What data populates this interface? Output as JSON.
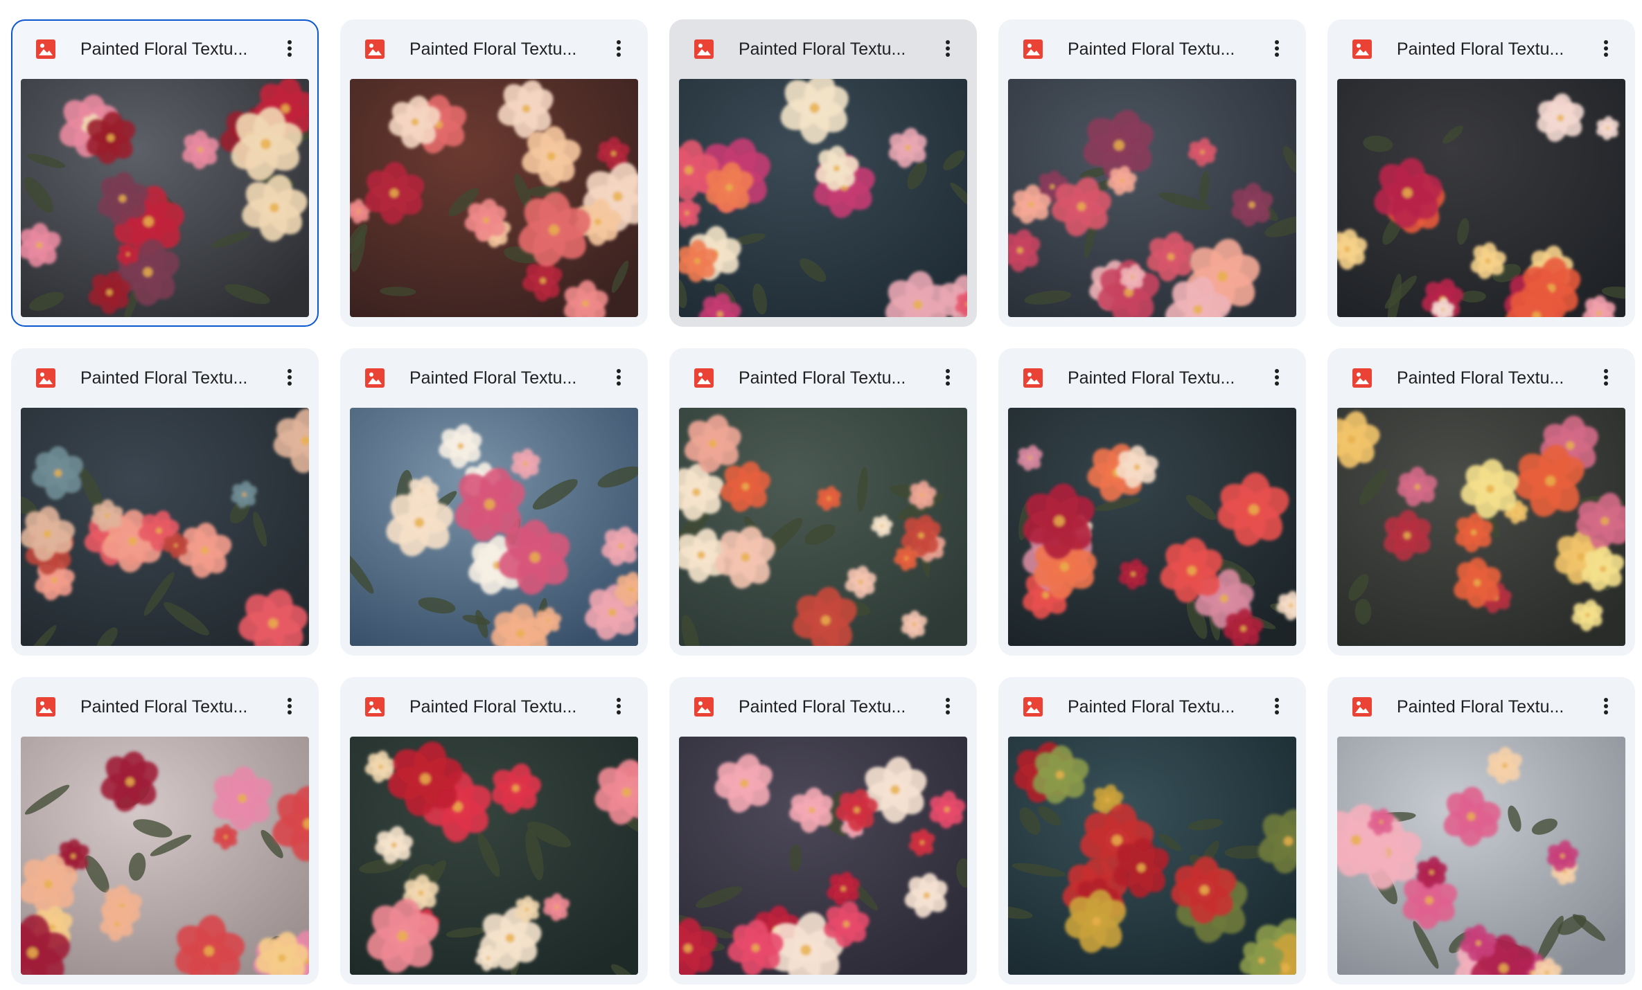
{
  "files": [
    {
      "name": "Painted Floral Textu...",
      "icon": "image-file-icon",
      "state": "selected",
      "palette": {
        "bg": "#2d2f33",
        "fog": "#5d6068",
        "flowers": [
          "#e98aa0",
          "#c2243a",
          "#f1d8b4",
          "#9a1c2b",
          "#7a3a52"
        ]
      }
    },
    {
      "name": "Painted Floral Textu...",
      "icon": "image-file-icon",
      "state": "normal",
      "palette": {
        "bg": "#3a2220",
        "fog": "#6b3a30",
        "flowers": [
          "#f4d6c2",
          "#f08a8a",
          "#f6c89e",
          "#b4263a",
          "#e36a6a"
        ]
      }
    },
    {
      "name": "Painted Floral Textu...",
      "icon": "image-file-icon",
      "state": "hover",
      "palette": {
        "bg": "#1f2c35",
        "fog": "#3b4a55",
        "flowers": [
          "#e9a7b2",
          "#c53a72",
          "#f3e3c8",
          "#e4566e",
          "#f07b52"
        ]
      }
    },
    {
      "name": "Painted Floral Textu...",
      "icon": "image-file-icon",
      "state": "normal",
      "palette": {
        "bg": "#2a3038",
        "fog": "#4c5560",
        "flowers": [
          "#f0b4b8",
          "#d9576a",
          "#f5a896",
          "#8a3a5a",
          "#c84260"
        ]
      }
    },
    {
      "name": "Painted Floral Textu...",
      "icon": "image-file-icon",
      "state": "normal",
      "palette": {
        "bg": "#1f2226",
        "fog": "#3a3a3e",
        "flowers": [
          "#f6d28a",
          "#f3d9d0",
          "#b8234a",
          "#e85a3c",
          "#f2a0ac"
        ]
      }
    },
    {
      "name": "Painted Floral Textu...",
      "icon": "image-file-icon",
      "state": "normal",
      "palette": {
        "bg": "#232a30",
        "fog": "#3b4650",
        "flowers": [
          "#f39c8c",
          "#e85a64",
          "#e0b49a",
          "#c0453c",
          "#6f8c94"
        ]
      }
    },
    {
      "name": "Painted Floral Textu...",
      "icon": "image-file-icon",
      "state": "normal",
      "palette": {
        "bg": "#39506a",
        "fog": "#7a93a8",
        "flowers": [
          "#f6e0c8",
          "#f3b08a",
          "#f0a6b0",
          "#f6efe4",
          "#d8567a"
        ]
      }
    },
    {
      "name": "Painted Floral Textu...",
      "icon": "image-file-icon",
      "state": "normal",
      "palette": {
        "bg": "#2d3a36",
        "fog": "#4b5a52",
        "flowers": [
          "#f0a696",
          "#f6e4cc",
          "#e6603e",
          "#f4c4b0",
          "#c8483c"
        ]
      }
    },
    {
      "name": "Painted Floral Textu...",
      "icon": "image-file-icon",
      "state": "normal",
      "palette": {
        "bg": "#1c2428",
        "fog": "#34434a",
        "flowers": [
          "#f6dcc6",
          "#b0203a",
          "#e8504c",
          "#d88aa0",
          "#f0744c"
        ]
      }
    },
    {
      "name": "Painted Floral Textu...",
      "icon": "image-file-icon",
      "state": "normal",
      "palette": {
        "bg": "#2a2c2a",
        "fog": "#4a4c48",
        "flowers": [
          "#f2c46a",
          "#d46a86",
          "#e8603a",
          "#f4e08c",
          "#b63040"
        ]
      }
    },
    {
      "name": "Painted Floral Textu...",
      "icon": "image-file-icon",
      "state": "normal",
      "palette": {
        "bg": "#9a8e8e",
        "fog": "#d4c8c8",
        "flowers": [
          "#d8464a",
          "#a01e38",
          "#f2b290",
          "#e888aa",
          "#f6cc8a"
        ]
      }
    },
    {
      "name": "Painted Floral Textu...",
      "icon": "image-file-icon",
      "state": "normal",
      "palette": {
        "bg": "#1e2a28",
        "fog": "#36443e",
        "flowers": [
          "#e0344a",
          "#f5e3cc",
          "#f08a94",
          "#f2d8b0",
          "#c02030"
        ]
      }
    },
    {
      "name": "Painted Floral Textu...",
      "icon": "image-file-icon",
      "state": "normal",
      "palette": {
        "bg": "#2c2a36",
        "fog": "#4c4858",
        "flowers": [
          "#f6e2d2",
          "#e84a6c",
          "#c0203c",
          "#f4a8b4",
          "#d03040"
        ]
      }
    },
    {
      "name": "Painted Floral Textu...",
      "icon": "image-file-icon",
      "state": "normal",
      "palette": {
        "bg": "#1a2a30",
        "fog": "#385058",
        "flowers": [
          "#b2202a",
          "#c83030",
          "#8a9a4a",
          "#caa23a",
          "#6e7a3a"
        ]
      }
    },
    {
      "name": "Painted Floral Textu...",
      "icon": "image-file-icon",
      "state": "normal",
      "palette": {
        "bg": "#8a8e96",
        "fog": "#c8ccd2",
        "flowers": [
          "#f4b0bc",
          "#c83e7a",
          "#f6d0a8",
          "#e0628e",
          "#b02050"
        ]
      }
    }
  ]
}
